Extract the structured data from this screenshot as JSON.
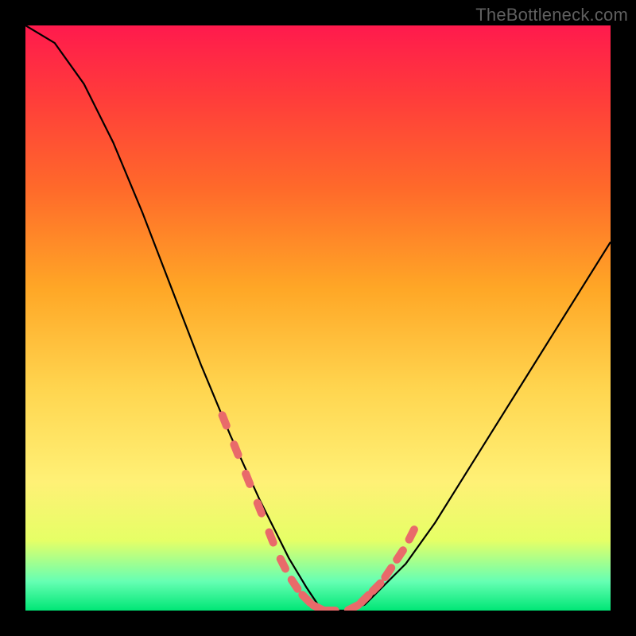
{
  "watermark": "TheBottleneck.com",
  "chart_data": {
    "type": "line",
    "title": "",
    "xlabel": "",
    "ylabel": "",
    "xlim": [
      0,
      100
    ],
    "ylim": [
      0,
      100
    ],
    "grid": false,
    "legend": false,
    "series": [
      {
        "name": "bottleneck-curve",
        "x": [
          0,
          5,
          10,
          15,
          20,
          25,
          30,
          35,
          40,
          45,
          48,
          50,
          52,
          55,
          58,
          60,
          65,
          70,
          75,
          80,
          85,
          90,
          95,
          100
        ],
        "y": [
          100,
          97,
          90,
          80,
          68,
          55,
          42,
          30,
          19,
          9,
          4,
          1,
          0,
          0,
          1,
          3,
          8,
          15,
          23,
          31,
          39,
          47,
          55,
          63
        ]
      }
    ],
    "highlight_segments": [
      {
        "name": "left-dashed",
        "x": [
          33,
          35,
          37,
          39,
          41,
          43,
          45,
          47,
          49,
          51,
          53
        ],
        "y": [
          35,
          30,
          25,
          20,
          15,
          10,
          6,
          3,
          1,
          0,
          0
        ]
      },
      {
        "name": "right-dashed",
        "x": [
          55,
          57,
          59,
          61,
          63,
          65,
          67
        ],
        "y": [
          0,
          1,
          3,
          5,
          8,
          11,
          15
        ]
      }
    ],
    "gradient_stops": [
      {
        "pos": 0.0,
        "color": "#ff1a4d"
      },
      {
        "pos": 0.12,
        "color": "#ff3b3b"
      },
      {
        "pos": 0.28,
        "color": "#ff6a2a"
      },
      {
        "pos": 0.45,
        "color": "#ffa726"
      },
      {
        "pos": 0.62,
        "color": "#ffd54f"
      },
      {
        "pos": 0.78,
        "color": "#fff176"
      },
      {
        "pos": 0.88,
        "color": "#e6ff66"
      },
      {
        "pos": 0.95,
        "color": "#66ffb3"
      },
      {
        "pos": 1.0,
        "color": "#00e676"
      }
    ]
  }
}
